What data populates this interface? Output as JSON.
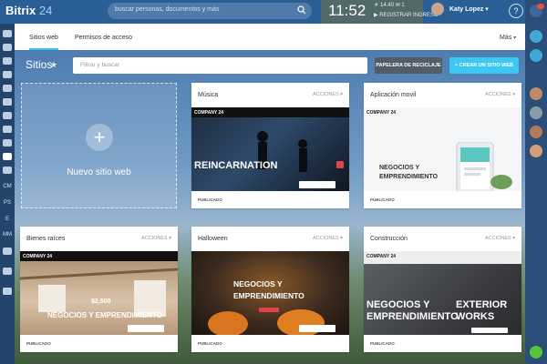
{
  "app": {
    "brand": "Bitrix",
    "version": "24"
  },
  "topbar": {
    "search_placeholder": "buscar personas, documentos y más",
    "clock": "11:52",
    "clock_small": "☀ 14:40  ✉ 1",
    "register": "▶ REGISTRAR INGRESO",
    "username": "Katy Lopez",
    "username_caret": "▾",
    "help": "?"
  },
  "tabs": {
    "sites": "Sitios web",
    "access": "Permisos de acceso",
    "more": "Más",
    "more_chevron": "▾"
  },
  "header": {
    "title": "Sitios",
    "filter_placeholder": "Filtrar y buscar",
    "trash_button": "PAPELERA DE RECICLAJE",
    "create_button": "+ CREAR UN SITIO WEB"
  },
  "new_site": {
    "plus": "+",
    "label": "Nuevo sitio web"
  },
  "cards": [
    {
      "title": "Música",
      "actions": "ACCIONES ▾",
      "status": "PUBLICADO",
      "logo": "COMPANY 24",
      "headline": "REINCARNATION"
    },
    {
      "title": "Aplicación movil",
      "actions": "ACCIONES ▾",
      "status": "PUBLICADO",
      "logo": "COMPANY 24",
      "headline_1": "NEGOCIOS Y",
      "headline_2": "EMPRENDIMIENTO"
    },
    {
      "title": "Bienes raíces",
      "actions": "ACCIONES ▾",
      "status": "PUBLICADO",
      "logo": "COMPANY 24",
      "price": "$2,500",
      "headline": "NEGOCIOS Y EMPRENDIMIENTO"
    },
    {
      "title": "Halloween",
      "actions": "ACCIONES ▾",
      "status": "PUBLICADO",
      "headline_1": "NEGOCIOS Y",
      "headline_2": "EMPRENDIMIENTO"
    },
    {
      "title": "Construcción",
      "actions": "ACCIONES ▾",
      "status": "PUBLICADO",
      "logo": "COMPANY 24",
      "headline_1": "NEGOCIOS Y",
      "headline_2": "EMPRENDIMIENTO",
      "headline_3": "EXTERIOR",
      "headline_4": "WORKS"
    }
  ],
  "leftbar": {
    "cm": "CM",
    "ps": "PS",
    "e": "E",
    "mm": "MM"
  },
  "colors": {
    "accent": "#2fc6f6",
    "topbar": "#2a5f95",
    "trash": "#535c69",
    "create": "#3bc8f5"
  }
}
